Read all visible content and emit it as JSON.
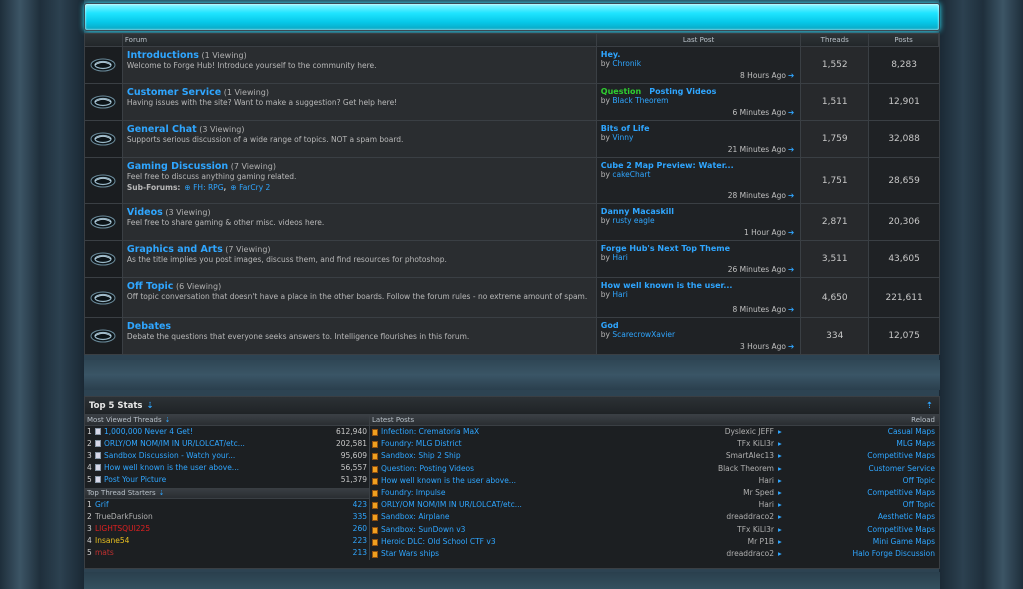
{
  "colors": {
    "accent": "#2fa6ff",
    "glow": "#1fe4ff",
    "prefix": "#2fcf2f"
  },
  "header": {
    "forum": "Forum",
    "last_post": "Last Post",
    "threads": "Threads",
    "posts": "Posts"
  },
  "forums": [
    {
      "title": "Introductions",
      "viewing": "(1 Viewing)",
      "desc": "Welcome to Forge Hub! Introduce yourself to the community here.",
      "lp_prefix": "",
      "lp_title": "Hey.",
      "lp_by": "Chronik",
      "lp_time": "8 Hours Ago",
      "threads": "1,552",
      "posts": "8,283"
    },
    {
      "title": "Customer Service",
      "viewing": "(1 Viewing)",
      "desc": "Having issues with the site? Want to make a suggestion? Get help here!",
      "lp_prefix": "Question",
      "lp_title": "Posting Videos",
      "lp_by": "Black Theorem",
      "lp_time": "6 Minutes Ago",
      "threads": "1,511",
      "posts": "12,901"
    },
    {
      "title": "General Chat",
      "viewing": "(3 Viewing)",
      "desc": "Supports serious discussion of a wide range of topics. NOT a spam board.",
      "lp_prefix": "",
      "lp_title": "Bits of Life",
      "lp_by": "Vinny",
      "lp_time": "21 Minutes Ago",
      "threads": "1,759",
      "posts": "32,088"
    },
    {
      "title": "Gaming Discussion",
      "viewing": "(7 Viewing)",
      "desc": "Feel free to discuss anything gaming related.",
      "lp_prefix": "",
      "lp_title": "Cube 2 Map Preview: Water...",
      "lp_by": "cakeChart",
      "lp_time": "28 Minutes Ago",
      "threads": "1,751",
      "posts": "28,659",
      "subforums_label": "Sub-Forums:",
      "subforums": [
        "FH: RPG",
        "FarCry 2"
      ]
    },
    {
      "title": "Videos",
      "viewing": "(3 Viewing)",
      "desc": "Feel free to share gaming & other misc. videos here.",
      "lp_prefix": "",
      "lp_title": "Danny Macaskill",
      "lp_by": "rusty eagle",
      "lp_time": "1 Hour Ago",
      "threads": "2,871",
      "posts": "20,306"
    },
    {
      "title": "Graphics and Arts",
      "viewing": "(7 Viewing)",
      "desc": "As the title implies you post images, discuss them, and find resources for photoshop.",
      "lp_prefix": "",
      "lp_title": "Forge Hub's Next Top Theme",
      "lp_by": "Hari",
      "lp_time": "26 Minutes Ago",
      "threads": "3,511",
      "posts": "43,605"
    },
    {
      "title": "Off Topic",
      "viewing": "(6 Viewing)",
      "desc": "Off topic conversation that doesn't have a place in the other boards. Follow the forum rules - no extreme amount of spam.",
      "lp_prefix": "",
      "lp_title": "How well known is the user...",
      "lp_by": "Hari",
      "lp_time": "8 Minutes Ago",
      "threads": "4,650",
      "posts": "221,611"
    },
    {
      "title": "Debates",
      "viewing": "",
      "desc": "Debate the questions that everyone seeks answers to. Intelligence flourishes in this forum.",
      "lp_prefix": "",
      "lp_title": "God",
      "lp_by": "ScarecrowXavier",
      "lp_time": "3 Hours Ago",
      "threads": "334",
      "posts": "12,075"
    }
  ],
  "by_label": "by",
  "stats": {
    "title": "Top 5 Stats",
    "most_viewed_label": "Most Viewed Threads",
    "most_viewed": [
      {
        "n": "1",
        "t": "1,000,000 Never 4 Get!",
        "v": "612,940"
      },
      {
        "n": "2",
        "t": "ORLY/OM NOM/IM IN UR/LOLCAT/etc...",
        "v": "202,581"
      },
      {
        "n": "3",
        "t": "Sandbox Discussion - Watch your...",
        "v": "95,609"
      },
      {
        "n": "4",
        "t": "How well known is the user above...",
        "v": "56,557"
      },
      {
        "n": "5",
        "t": "Post Your Picture",
        "v": "51,379"
      }
    ],
    "starters_label": "Top Thread Starters",
    "starters": [
      {
        "n": "1",
        "t": "Grif",
        "v": "423"
      },
      {
        "n": "2",
        "t": "TrueDarkFusion",
        "v": "335"
      },
      {
        "n": "3",
        "t": "LIGHTSQUI225",
        "v": "260"
      },
      {
        "n": "4",
        "t": "Insane54",
        "v": "223"
      },
      {
        "n": "5",
        "t": "mats",
        "v": "213"
      }
    ],
    "latest_label": "Latest Posts",
    "reload_label": "Reload",
    "latest": [
      {
        "t": "Infection: Crematoria MaX",
        "u": "Dyslexic JEFF",
        "f": "Casual Maps"
      },
      {
        "t": "Foundry: MLG District",
        "u": "TFx KiLl3r",
        "f": "MLG Maps"
      },
      {
        "t": "Sandbox: Ship 2 Ship",
        "u": "SmartAlec13",
        "f": "Competitive Maps"
      },
      {
        "t": "Question: Posting Videos",
        "u": "Black Theorem",
        "f": "Customer Service"
      },
      {
        "t": "How well known is the user above...",
        "u": "Hari",
        "f": "Off Topic"
      },
      {
        "t": "Foundry: Impulse",
        "u": "Mr Sped",
        "f": "Competitive Maps"
      },
      {
        "t": "ORLY/OM NOM/IM IN UR/LOLCAT/etc...",
        "u": "Hari",
        "f": "Off Topic"
      },
      {
        "t": "Sandbox: Airplane",
        "u": "dreaddraco2",
        "f": "Aesthetic Maps"
      },
      {
        "t": "Sandbox: SunDown v3",
        "u": "TFx KiLl3r",
        "f": "Competitive Maps"
      },
      {
        "t": "Heroic DLC: Old School CTF v3",
        "u": "Mr P1B",
        "f": "Mini Game Maps"
      },
      {
        "t": "Star Wars ships",
        "u": "dreaddraco2",
        "f": "Halo Forge Discussion"
      }
    ]
  }
}
